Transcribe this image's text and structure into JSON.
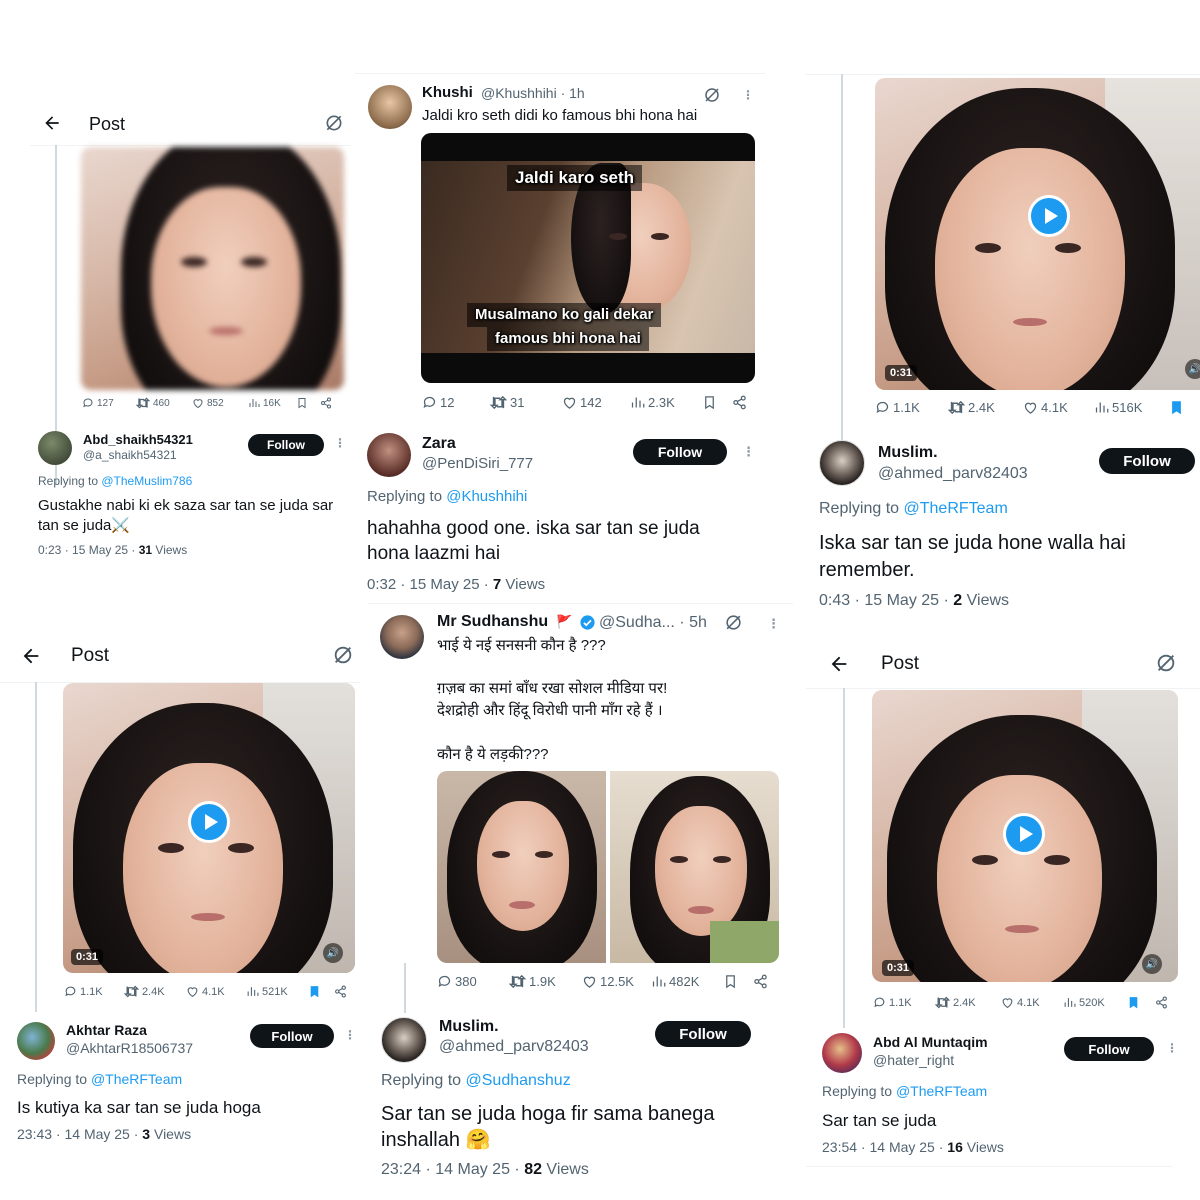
{
  "colors": {
    "accent": "#1d9bf0",
    "text": "#0f1419",
    "muted": "#536471",
    "button": "#0f1419"
  },
  "p1": {
    "header_title": "Post",
    "stats": {
      "replies": "127",
      "reposts": "460",
      "likes": "852",
      "views": "16K"
    },
    "user": {
      "name": "Abd_shaikh54321",
      "handle": "@a_shaikh54321",
      "follow": "Follow"
    },
    "replying_prefix": "Replying to ",
    "replying_to": "@TheMuslim786",
    "text": "Gustakhe nabi ki ek saza sar tan se juda sar tan se juda⚔️",
    "meta_time": "0:23 · 15 May 25 · ",
    "meta_views_count": "31",
    "meta_views_label": " Views"
  },
  "p2": {
    "tweet_user": {
      "name": "Khushi",
      "handle": "@Khushhihi · 1h"
    },
    "tweet_text": "Jaldi kro seth didi ko famous bhi hona hai",
    "meme_top": "Jaldi karo seth",
    "meme_bottom_1": "Musalmano ko gali dekar",
    "meme_bottom_2": "famous bhi hona hai",
    "stats": {
      "replies": "12",
      "reposts": "31",
      "likes": "142",
      "views": "2.3K"
    },
    "user": {
      "name": "Zara",
      "handle": "@PenDiSiri_777",
      "follow": "Follow"
    },
    "replying_prefix": "Replying to ",
    "replying_to": "@Khushhihi",
    "text": "hahahha good one. iska sar tan se juda hona laazmi hai",
    "meta_time": "0:32 · 15 May 25 · ",
    "meta_views_count": "7",
    "meta_views_label": " Views"
  },
  "p3": {
    "duration": "0:31",
    "stats": {
      "replies": "1.1K",
      "reposts": "2.4K",
      "likes": "4.1K",
      "views": "516K"
    },
    "user": {
      "name": "Muslim.",
      "handle": "@ahmed_parv82403",
      "follow": "Follow"
    },
    "replying_prefix": "Replying to ",
    "replying_to": "@TheRFTeam",
    "text": "Iska sar tan se juda hone walla hai remember.",
    "meta_time": "0:43 · 15 May 25 · ",
    "meta_views_count": "2",
    "meta_views_label": " Views"
  },
  "p4": {
    "header_title": "Post",
    "duration": "0:31",
    "stats": {
      "replies": "1.1K",
      "reposts": "2.4K",
      "likes": "4.1K",
      "views": "521K"
    },
    "user": {
      "name": "Akhtar Raza",
      "handle": "@AkhtarR18506737",
      "follow": "Follow"
    },
    "replying_prefix": "Replying to ",
    "replying_to": "@TheRFTeam",
    "text": "Is kutiya ka sar tan se juda hoga",
    "meta_time": "23:43 · 14 May 25 · ",
    "meta_views_count": "3",
    "meta_views_label": " Views"
  },
  "p5": {
    "tweet_user": {
      "name": "Mr Sudhanshu",
      "handle": "@Sudha... · 5h"
    },
    "tweet_line1": "भाई ये नई सनसनी कौन है ???",
    "tweet_line2": "ग़ज़ब का समां बाँध रखा सोशल मीडिया पर!",
    "tweet_line3": "देशद्रोही और हिंदू विरोधी पानी माँग रहे हैं ।",
    "tweet_line4": "कौन है ये लड़की???",
    "stats": {
      "replies": "380",
      "reposts": "1.9K",
      "likes": "12.5K",
      "views": "482K"
    },
    "user": {
      "name": "Muslim.",
      "handle": "@ahmed_parv82403",
      "follow": "Follow"
    },
    "replying_prefix": "Replying to ",
    "replying_to": "@Sudhanshuz",
    "text": "Sar tan se juda hoga fir sama banega inshallah 🤗",
    "meta_time": "23:24 · 14 May 25 · ",
    "meta_views_count": "82",
    "meta_views_label": " Views"
  },
  "p6": {
    "header_title": "Post",
    "duration": "0:31",
    "stats": {
      "replies": "1.1K",
      "reposts": "2.4K",
      "likes": "4.1K",
      "views": "520K"
    },
    "user": {
      "name": "Abd Al Muntaqim",
      "handle": "@hater_right",
      "follow": "Follow"
    },
    "replying_prefix": "Replying to ",
    "replying_to": "@TheRFTeam",
    "text": "Sar tan se juda",
    "meta_time": "23:54 · 14 May 25 · ",
    "meta_views_count": "16",
    "meta_views_label": " Views"
  }
}
